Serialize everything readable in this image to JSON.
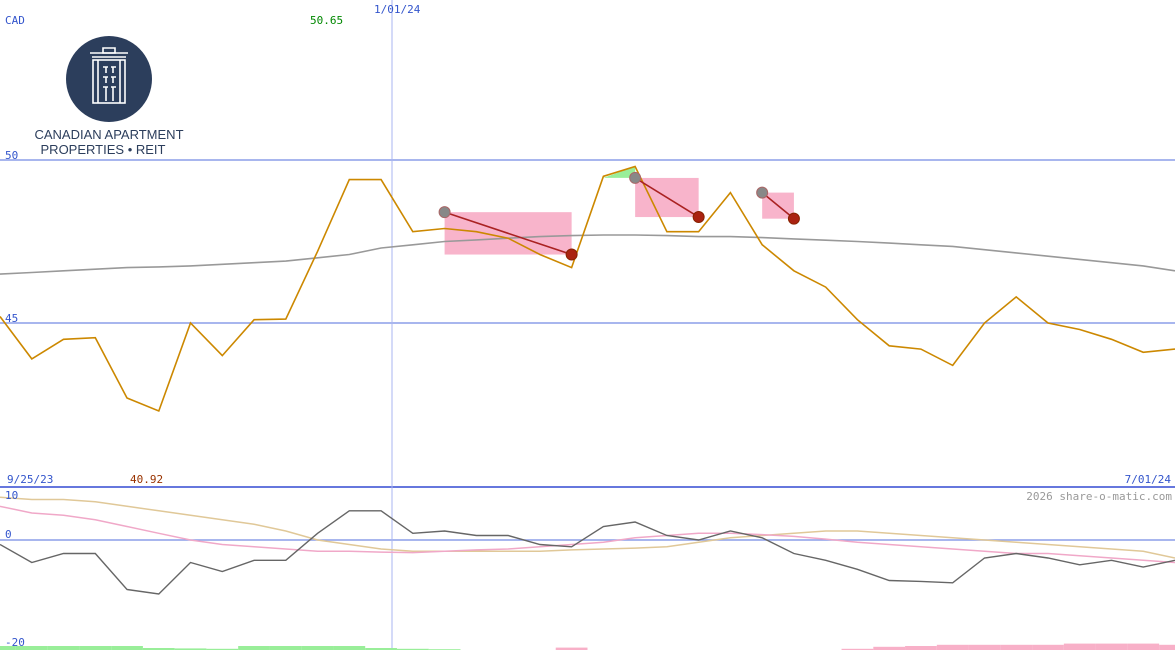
{
  "currency": "CAD",
  "high_label": "50.65",
  "low_label": "40.92",
  "start_date": "9/25/23",
  "end_date": "7/01/24",
  "year_marker": "1/01/24",
  "copyright": "2026 share-o-matic.com",
  "logo": {
    "line1": "CANADIAN APARTMENT",
    "line2": "PROPERTIES • REIT",
    "icon": "building-columns-icon"
  },
  "colors": {
    "price": "#cc8800",
    "moving_average": "#999999",
    "grid": "#8c9ee8",
    "up_label": "#008800",
    "down_label": "#993300",
    "signal_line": "#aa2222",
    "osc_main": "#666666",
    "osc_pink": "#f0a8c8",
    "osc_tan": "#e0c898",
    "bar_green": "#99ee99",
    "bar_pink": "#f8b0c8"
  },
  "chart_data": [
    {
      "type": "line",
      "title": "",
      "ylabel": "CAD",
      "ylim": [
        42.09,
        51.3
      ],
      "y_ticks": [
        "50",
        "45"
      ],
      "grid": true,
      "x_label_start": "9/25/23",
      "x_label_mid": "1/01/24",
      "x_label_end": "7/01/24",
      "series": [
        {
          "role": "price",
          "values": [
            45.2,
            43.9,
            44.5,
            44.55,
            42.7,
            42.3,
            45.0,
            44.0,
            45.1,
            45.12,
            47.2,
            49.4,
            49.4,
            47.8,
            47.9,
            47.8,
            47.6,
            47.1,
            46.7,
            49.5,
            49.8,
            47.8,
            47.8,
            49.0,
            47.4,
            46.6,
            46.1,
            45.1,
            44.3,
            44.2,
            43.7,
            45.0,
            45.8,
            45.0,
            44.8,
            44.5,
            44.1,
            44.2
          ],
          "x_note": "38 roughly weekly observations from 9/25/23 to 7/01/24"
        },
        {
          "role": "moving_average",
          "values": [
            46.5,
            46.55,
            46.6,
            46.65,
            46.7,
            46.72,
            46.75,
            46.8,
            46.85,
            46.9,
            47.0,
            47.1,
            47.3,
            47.4,
            47.5,
            47.55,
            47.6,
            47.65,
            47.68,
            47.7,
            47.7,
            47.68,
            47.65,
            47.65,
            47.62,
            47.58,
            47.54,
            47.5,
            47.45,
            47.4,
            47.35,
            47.25,
            47.15,
            47.05,
            46.95,
            46.85,
            46.75,
            46.6
          ]
        }
      ],
      "annotations": [
        {
          "kind": "down",
          "from_index": 14,
          "to_index": 18,
          "from_value": 48.4,
          "to_value": 47.1
        },
        {
          "kind": "down",
          "from_index": 20,
          "to_index": 22,
          "from_value": 49.45,
          "to_value": 48.25
        },
        {
          "kind": "down",
          "from_index": 24,
          "to_index": 25,
          "from_value": 49.0,
          "to_value": 48.2
        }
      ]
    },
    {
      "type": "line",
      "title": "",
      "ylim": [
        -20,
        10
      ],
      "y_ticks": [
        "10",
        "0",
        "-20"
      ],
      "grid": true,
      "series": [
        {
          "role": "main",
          "values": [
            -1,
            -5,
            -3,
            -3,
            -11,
            -12,
            -5,
            -7,
            -4.5,
            -4.5,
            1.5,
            6.5,
            6.5,
            1.5,
            2,
            1,
            1,
            -1,
            -1.5,
            3,
            4,
            1,
            0,
            2,
            0.5,
            -3,
            -4.5,
            -6.5,
            -9,
            -9.2,
            -9.5,
            -4,
            -3,
            -4,
            -5.5,
            -4.5,
            -6,
            -4.5
          ]
        },
        {
          "role": "pink",
          "values": [
            7.5,
            6,
            5.5,
            4.5,
            3,
            1.5,
            0,
            -1,
            -1.5,
            -2,
            -2.5,
            -2.5,
            -2.7,
            -2.8,
            -2.5,
            -2.2,
            -2,
            -1.5,
            -1,
            -0.5,
            0.5,
            1,
            1.5,
            1.5,
            1.2,
            0.8,
            0.2,
            -0.5,
            -1,
            -1.5,
            -2,
            -2.5,
            -3,
            -3,
            -3.5,
            -4,
            -4.5,
            -5
          ]
        },
        {
          "role": "tan",
          "values": [
            9.5,
            9,
            9,
            8.5,
            7.5,
            6.5,
            5.5,
            4.5,
            3.5,
            2,
            0,
            -1,
            -2,
            -2.5,
            -2.5,
            -2.5,
            -2.5,
            -2.5,
            -2.2,
            -2,
            -1.8,
            -1.5,
            -0.5,
            0.5,
            1,
            1.5,
            2,
            2,
            1.5,
            1,
            0.5,
            0,
            -0.5,
            -1,
            -1.5,
            -2,
            -2.5,
            -4
          ]
        }
      ],
      "bars": [
        1,
        1,
        1,
        1,
        1,
        0.5,
        0.4,
        0.3,
        1,
        1,
        1,
        1,
        0.5,
        0.3,
        0.2,
        0,
        0,
        0,
        -0.6,
        0,
        0,
        0,
        0,
        0,
        0,
        0,
        0,
        -0.3,
        -0.8,
        -1,
        -1.3,
        -1.3,
        -1.3,
        -1.3,
        -1.6,
        -1.6,
        -1.6,
        -1.3
      ]
    }
  ]
}
